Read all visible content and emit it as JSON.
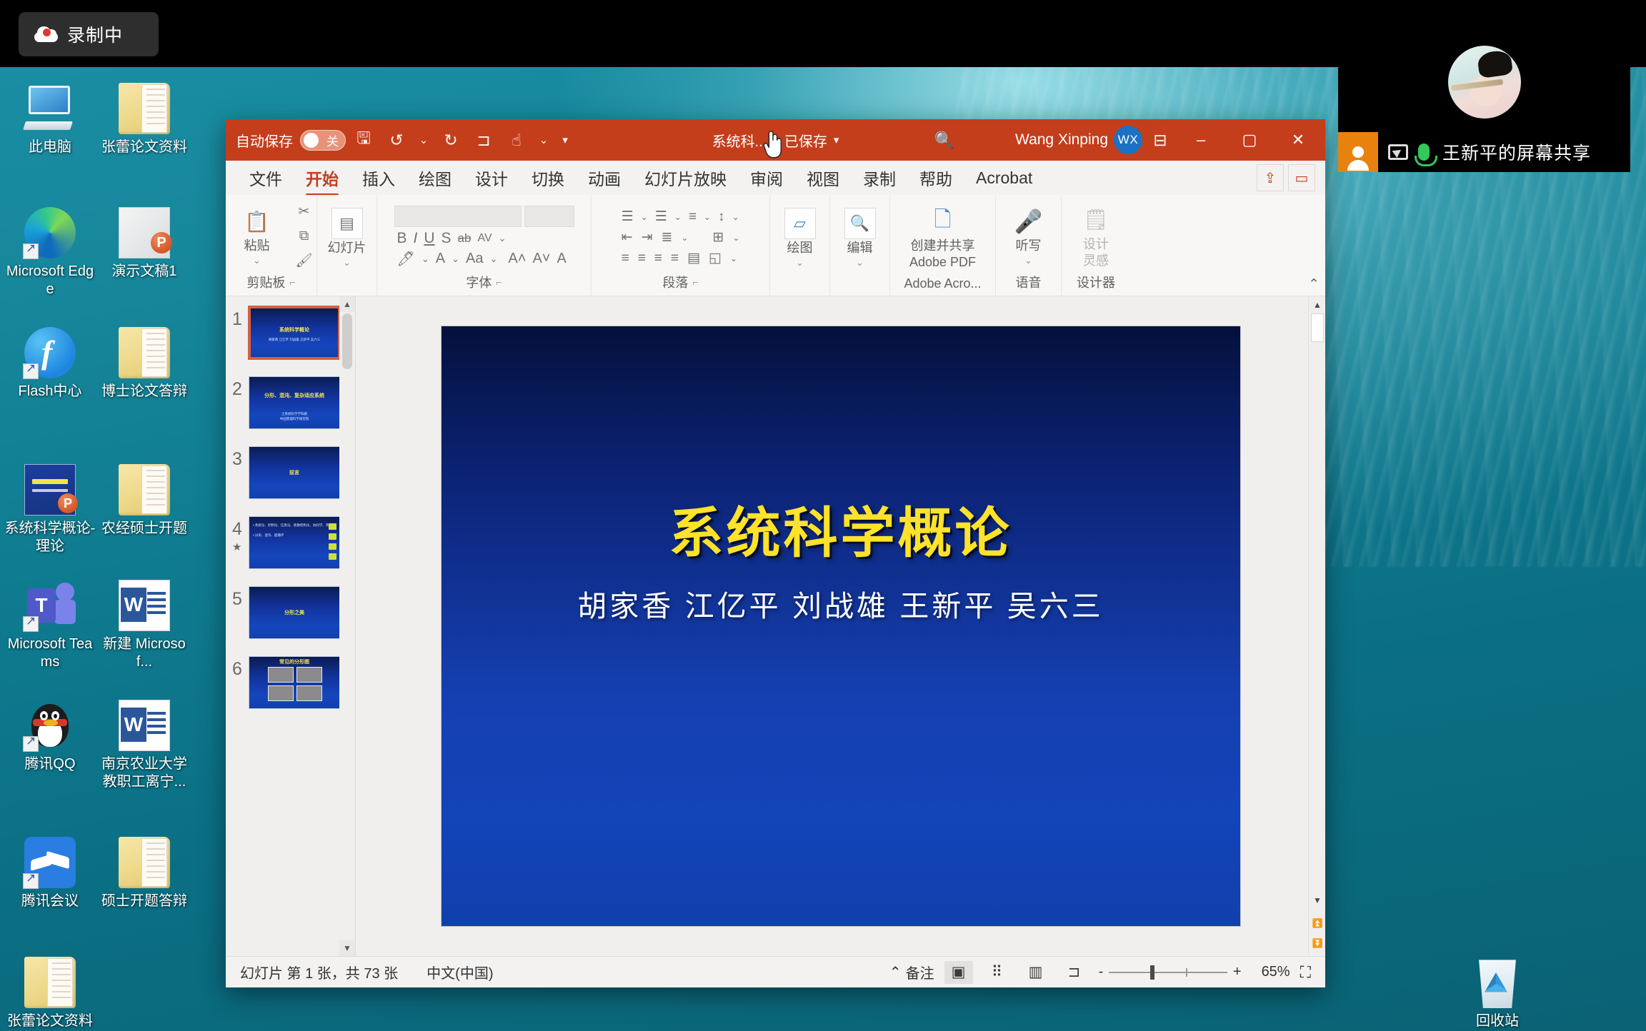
{
  "recording": {
    "label": "录制中",
    "icon": "cloud-record-icon"
  },
  "video_panel": {
    "label": "王新平的屏幕共享",
    "person_icon": "person-icon",
    "share_icon": "screen-share-icon",
    "mic_icon": "microphone-icon",
    "avatar_name": "participant-avatar"
  },
  "desktop": {
    "icons": [
      {
        "name": "此电脑",
        "glyph": "this-pc-icon"
      },
      {
        "name": "张蕾论文资料",
        "glyph": "folder-icon"
      },
      {
        "name": "Microsoft Edge",
        "glyph": "edge-icon"
      },
      {
        "name": "演示文稿1",
        "glyph": "powerpoint-file-icon"
      },
      {
        "name": "Flash中心",
        "glyph": "flash-icon"
      },
      {
        "name": "博士论文答辩",
        "glyph": "folder-icon"
      },
      {
        "name": "系统科学概论-理论",
        "glyph": "powerpoint-file-icon"
      },
      {
        "name": "农经硕士开题",
        "glyph": "folder-icon"
      },
      {
        "name": "Microsoft Teams",
        "glyph": "teams-icon"
      },
      {
        "name": "新建 Microsof...",
        "glyph": "word-icon"
      },
      {
        "name": "腾讯QQ",
        "glyph": "qq-icon"
      },
      {
        "name": "南京农业大学教职工离宁...",
        "glyph": "word-icon"
      },
      {
        "name": "腾讯会议",
        "glyph": "tencent-meeting-icon"
      },
      {
        "name": "硕士开题答辩",
        "glyph": "folder-icon"
      },
      {
        "name": "张蕾论文资料",
        "glyph": "folder-icon"
      },
      {
        "name": "回收站",
        "glyph": "recycle-bin-icon"
      }
    ]
  },
  "powerpoint": {
    "titlebar": {
      "autosave_label": "自动保存",
      "autosave_state": "关",
      "doc_name": "系统科...",
      "save_state": "已保存",
      "separator": "·",
      "user_name": "Wang Xinping",
      "avatar_initials": "WX",
      "quick_access": [
        "save-icon",
        "undo-icon",
        "redo-icon",
        "start-slideshow-icon",
        "touch-mode-icon",
        "customize-icon"
      ],
      "search_icon": "search-icon",
      "ribbon_display_icon": "ribbon-display-options-icon",
      "minimize": "–",
      "maximize": "▢",
      "close": "✕"
    },
    "tabs": [
      {
        "label": "文件",
        "active": false
      },
      {
        "label": "开始",
        "active": true
      },
      {
        "label": "插入",
        "active": false
      },
      {
        "label": "绘图",
        "active": false
      },
      {
        "label": "设计",
        "active": false
      },
      {
        "label": "切换",
        "active": false
      },
      {
        "label": "动画",
        "active": false
      },
      {
        "label": "幻灯片放映",
        "active": false
      },
      {
        "label": "审阅",
        "active": false
      },
      {
        "label": "视图",
        "active": false
      },
      {
        "label": "录制",
        "active": false
      },
      {
        "label": "帮助",
        "active": false
      },
      {
        "label": "Acrobat",
        "active": false
      }
    ],
    "tab_actions": [
      {
        "label": "共享",
        "icon": "share-icon"
      },
      {
        "label": "批注",
        "icon": "comment-icon"
      }
    ],
    "ribbon_groups": [
      {
        "name": "剪贴板",
        "paste_label": "粘贴",
        "items": [
          "cut-icon",
          "copy-icon",
          "format-painter-icon"
        ]
      },
      {
        "name": "幻灯片",
        "slide_label": "幻灯片"
      },
      {
        "name": "字体",
        "bold": "B",
        "italic": "I",
        "underline": "U",
        "strike": "S",
        "shadow": "ab",
        "spacing": "AV",
        "grow": "A",
        "shrink": "A",
        "clear": "A",
        "case": "Aa"
      },
      {
        "name": "段落"
      },
      {
        "name": "绘图",
        "label": "绘图"
      },
      {
        "name": "编辑",
        "label": "编辑"
      },
      {
        "name": "Adobe Acro...",
        "label": "创建并共享 Adobe PDF",
        "line1": "创建并共享",
        "line2": "Adobe PDF"
      },
      {
        "name": "语音",
        "label": "听写"
      },
      {
        "name": "设计器",
        "line1": "设计",
        "line2": "灵感"
      }
    ],
    "thumbnails": [
      {
        "num": "1",
        "selected": true,
        "title": "系统科学概论",
        "subtitle": "胡家香 江亿平 刘战雄 王新平 吴六三",
        "has_animation": false
      },
      {
        "num": "2",
        "selected": false,
        "title": "分形、混沌、复杂适应系统",
        "subtitle": "之系统科学学科群\n中国管理科学研究院",
        "has_animation": false
      },
      {
        "num": "3",
        "selected": false,
        "title": "前言",
        "subtitle": "",
        "has_animation": false
      },
      {
        "num": "4",
        "selected": false,
        "title": "",
        "subtitle": "",
        "has_animation": true
      },
      {
        "num": "5",
        "selected": false,
        "title": "分形之美",
        "subtitle": "",
        "has_animation": false
      },
      {
        "num": "6",
        "selected": false,
        "title": "常见的分形图",
        "subtitle": "",
        "has_animation": false
      }
    ],
    "slide": {
      "title": "系统科学概论",
      "authors": "胡家香 江亿平 刘战雄 王新平  吴六三",
      "title_color": "#ffe22a",
      "bg_color": "#1140ad"
    },
    "statusbar": {
      "slide_info": "幻灯片 第 1 张，共 73 张",
      "language": "中文(中国)",
      "notes_label": "备注",
      "views": [
        "normal-view-icon",
        "slide-sorter-icon",
        "reading-view-icon",
        "slideshow-icon"
      ],
      "zoom_out": "-",
      "zoom_in": "+",
      "zoom_level": "65%",
      "fit_icon": "fit-slide-icon"
    }
  }
}
